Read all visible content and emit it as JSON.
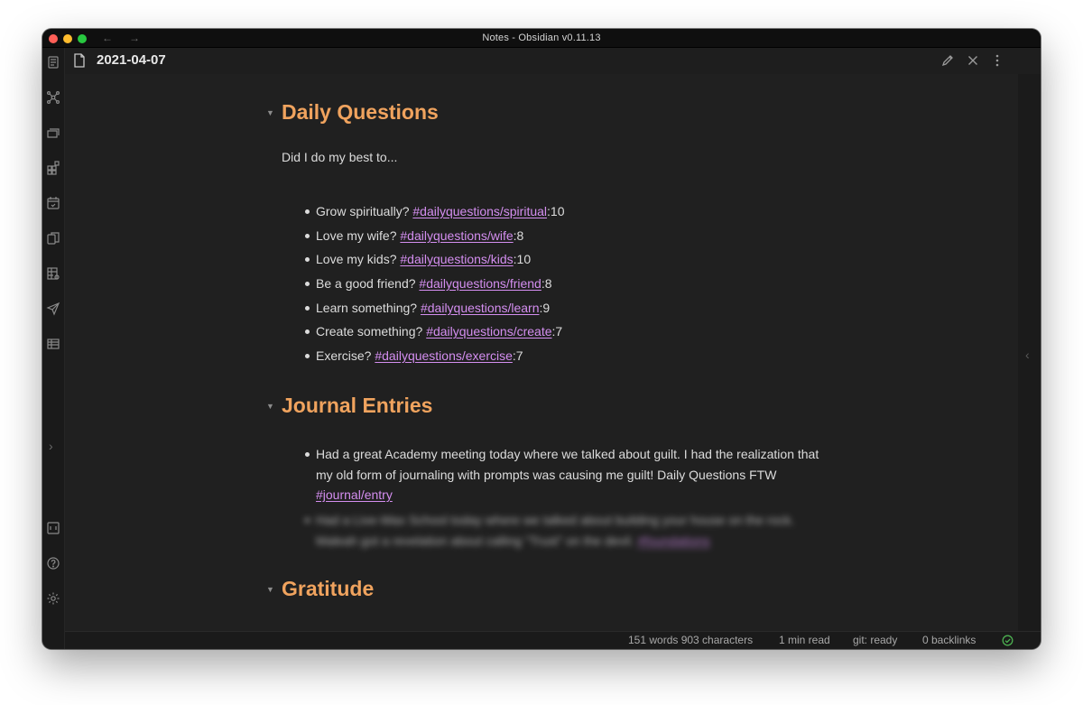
{
  "window": {
    "title": "Notes - Obsidian v0.11.13",
    "nav_back": "←",
    "nav_forward": "→"
  },
  "ribbon": {
    "icons": [
      "open-quick-switcher-icon",
      "graph-view-icon",
      "open-starred-icon",
      "templates-icon",
      "daily-note-calendar-icon",
      "copy-icon",
      "table-settings-icon",
      "publish-send-icon",
      "table-icon"
    ],
    "bottom_icons": [
      "vault-switcher-icon",
      "help-icon",
      "settings-icon"
    ],
    "expand_label": "›"
  },
  "note": {
    "title": "2021-04-07"
  },
  "sections": {
    "daily": {
      "heading": "Daily Questions",
      "intro": "Did I do my best to...",
      "items": [
        {
          "text": "Grow spiritually? ",
          "tag": "#dailyquestions/spiritual",
          "value": ":10"
        },
        {
          "text": "Love my wife? ",
          "tag": "#dailyquestions/wife",
          "value": ":8"
        },
        {
          "text": "Love my kids? ",
          "tag": "#dailyquestions/kids",
          "value": ":10"
        },
        {
          "text": "Be a good friend? ",
          "tag": "#dailyquestions/friend",
          "value": ":8"
        },
        {
          "text": "Learn something? ",
          "tag": "#dailyquestions/learn",
          "value": ":9"
        },
        {
          "text": "Create something? ",
          "tag": "#dailyquestions/create",
          "value": ":7"
        },
        {
          "text": "Exercise? ",
          "tag": "#dailyquestions/exercise",
          "value": ":7"
        }
      ]
    },
    "journal": {
      "heading": "Journal Entries",
      "entry1_line1": "Had a great Academy meeting today where we talked about guilt. I had the realization that",
      "entry1_line2": "my old form of journaling with prompts was causing me guilt! Daily Questions FTW",
      "entry1_tag": "#journal/entry",
      "entry2_line1": "Had a Live-Wax School today where we talked about building your house on the rock.",
      "entry2_line2": "Maleah got a revelation about calling \"Trust\" on the devil.",
      "entry2_tag": "#foundations"
    },
    "gratitude": {
      "heading": "Gratitude"
    }
  },
  "status": {
    "counts": "151 words 903 characters",
    "read_time": "1 min read",
    "git": "git: ready",
    "backlinks": "0 backlinks"
  },
  "colors": {
    "heading": "#f0a35e",
    "tag": "#d48ef0",
    "sync_ok": "#4caf50"
  }
}
